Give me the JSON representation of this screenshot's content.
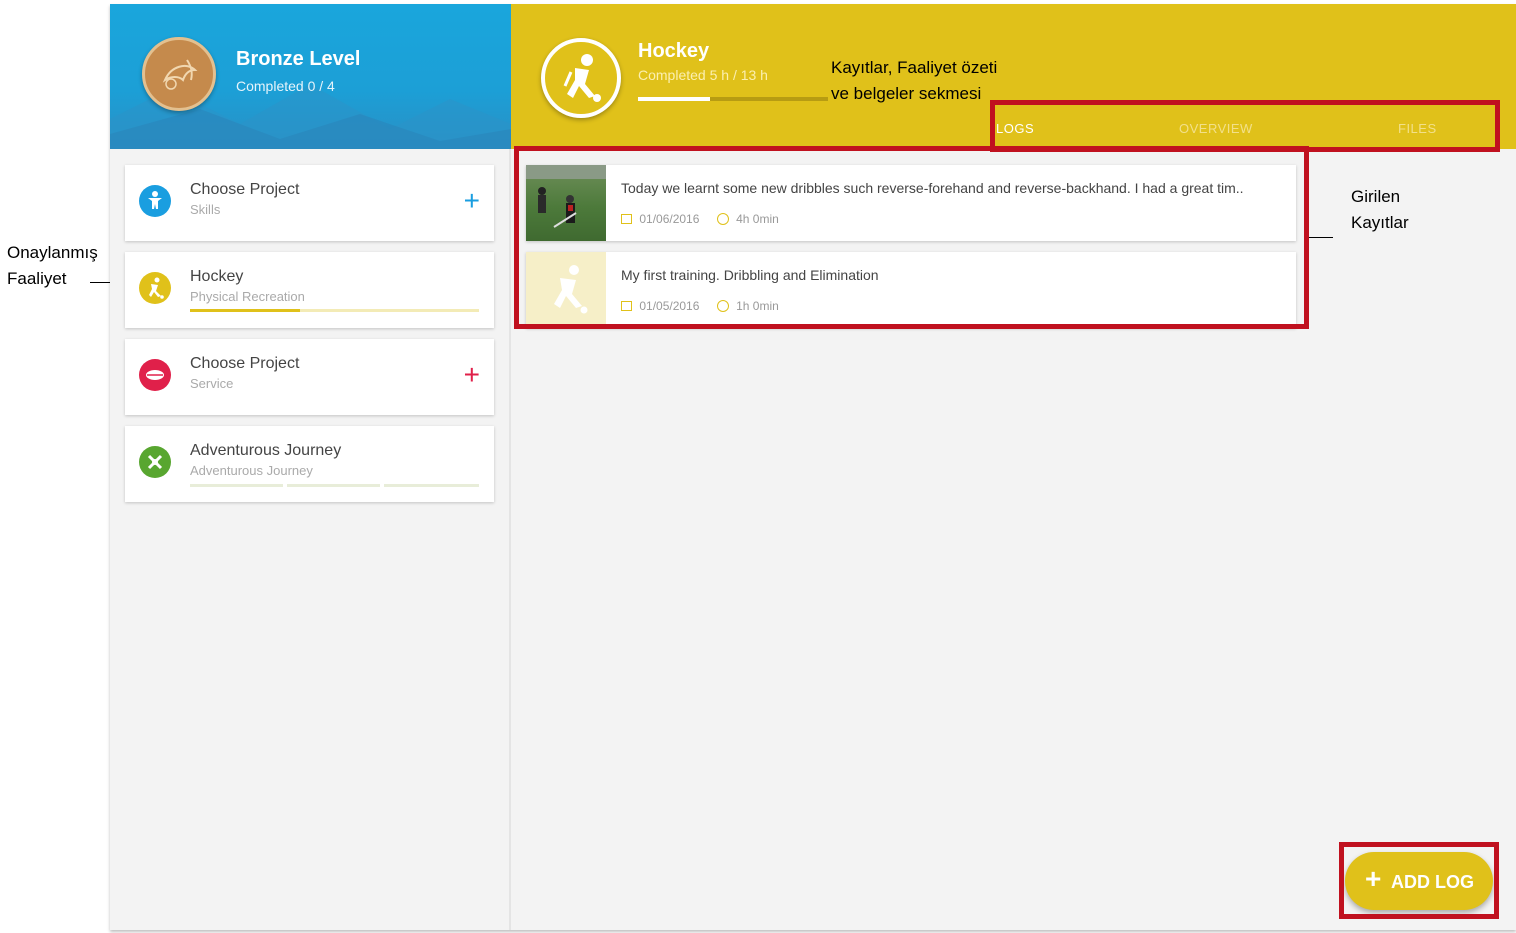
{
  "annotations": {
    "approved_activity": "Onaylanmış\nFaaliyet",
    "approved_activity_line1": "Onaylanmış",
    "approved_activity_line2": "Faaliyet",
    "tabs_note_line1": "Kayıtlar, Faaliyet özeti",
    "tabs_note_line2": "ve belgeler sekmesi",
    "entered_logs_line1": "Girilen",
    "entered_logs_line2": "Kayıtlar"
  },
  "level": {
    "title": "Bronze Level",
    "subtitle": "Completed 0 / 4"
  },
  "activity": {
    "title": "Hockey",
    "subtitle": "Completed 5 h / 13 h",
    "progress": 0.38
  },
  "tabs": [
    {
      "label": "LOGS"
    },
    {
      "label": "OVERVIEW"
    },
    {
      "label": "FILES"
    }
  ],
  "sidebar": {
    "items": [
      {
        "title": "Choose Project",
        "subtitle": "Skills"
      },
      {
        "title": "Hockey",
        "subtitle": "Physical Recreation",
        "progress": 0.38
      },
      {
        "title": "Choose Project",
        "subtitle": "Service"
      },
      {
        "title": "Adventurous Journey",
        "subtitle": "Adventurous Journey"
      }
    ]
  },
  "logs": [
    {
      "text": "Today we learnt some new dribbles such reverse-forehand and reverse-backhand. I had a great tim..",
      "date": "01/06/2016",
      "duration": "4h 0min"
    },
    {
      "text": "My first training. Dribbling and Elimination",
      "date": "01/05/2016",
      "duration": "1h 0min"
    }
  ],
  "add_log": {
    "label": "ADD LOG",
    "icon": "plus-icon"
  },
  "colors": {
    "level_blue": "#1aa6dc",
    "activity_yellow": "#e0c11a",
    "annotation_red": "#c0111f",
    "skills_blue": "#1a9ee0",
    "service_red": "#e0204a",
    "journey_green": "#58a630"
  }
}
